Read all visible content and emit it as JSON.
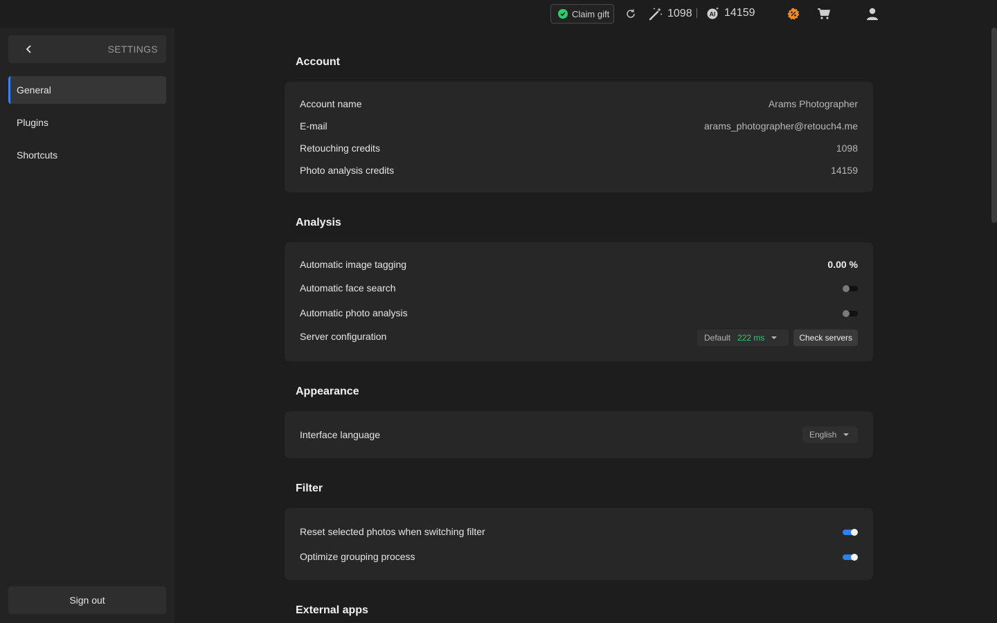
{
  "topbar": {
    "claim_gift": "Claim gift",
    "retouch_credits": "1098",
    "analysis_credits": "14159"
  },
  "sidebar": {
    "settings_label": "SETTINGS",
    "items": [
      {
        "label": "General",
        "active": true
      },
      {
        "label": "Plugins",
        "active": false
      },
      {
        "label": "Shortcuts",
        "active": false
      }
    ],
    "sign_out": "Sign out"
  },
  "account": {
    "title": "Account",
    "rows": [
      {
        "label": "Account name",
        "value": "Arams Photographer"
      },
      {
        "label": "E-mail",
        "value": "arams_photographer@retouch4.me"
      },
      {
        "label": "Retouching credits",
        "value": "1098"
      },
      {
        "label": "Photo analysis credits",
        "value": "14159"
      }
    ]
  },
  "analysis": {
    "title": "Analysis",
    "tagging_label": "Automatic image tagging",
    "tagging_value": "0.00 %",
    "face_search_label": "Automatic face search",
    "face_search_on": false,
    "photo_analysis_label": "Automatic photo analysis",
    "photo_analysis_on": false,
    "server_label": "Server configuration",
    "server_select": "Default",
    "server_latency": "222 ms",
    "check_servers": "Check servers"
  },
  "appearance": {
    "title": "Appearance",
    "language_label": "Interface language",
    "language_value": "English"
  },
  "filter": {
    "title": "Filter",
    "reset_label": "Reset selected photos when switching filter",
    "reset_on": true,
    "optimize_label": "Optimize grouping process",
    "optimize_on": true
  },
  "external_apps": {
    "title": "External apps"
  },
  "colors": {
    "accent": "#3b82f6",
    "success": "#2ecc71",
    "promo": "#f08a24"
  }
}
